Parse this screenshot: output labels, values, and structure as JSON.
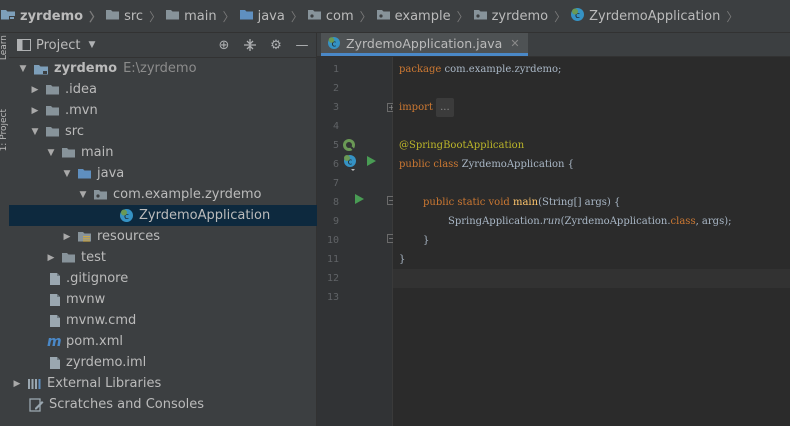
{
  "navbar": {
    "crumbs": [
      "zyrdemo",
      "src",
      "main",
      "java",
      "com",
      "example",
      "zyrdemo",
      "ZyrdemoApplication"
    ]
  },
  "strip": {
    "tab_top": "Learn",
    "tab_project": "1: Project"
  },
  "project_panel": {
    "title": "Project",
    "tree": [
      {
        "label": "zyrdemo",
        "hint": "E:\\zyrdemo"
      },
      {
        "label": ".idea"
      },
      {
        "label": ".mvn"
      },
      {
        "label": "src"
      },
      {
        "label": "main"
      },
      {
        "label": "java"
      },
      {
        "label": "com.example.zyrdemo"
      },
      {
        "label": "ZyrdemoApplication"
      },
      {
        "label": "resources"
      },
      {
        "label": "test"
      },
      {
        "label": ".gitignore"
      },
      {
        "label": "mvnw"
      },
      {
        "label": "mvnw.cmd"
      },
      {
        "label": "pom.xml"
      },
      {
        "label": "zyrdemo.iml"
      },
      {
        "label": "External Libraries"
      },
      {
        "label": "Scratches and Consoles"
      }
    ]
  },
  "editor": {
    "tab_label": "ZyrdemoApplication.java",
    "line_numbers": [
      "1",
      "2",
      "3",
      "4",
      "5",
      "6",
      "7",
      "8",
      "9",
      "10",
      "11",
      "12",
      "13"
    ],
    "code": {
      "l1_kw": "package",
      "l1_rest": " com.example.zyrdemo;",
      "l3_kw": "import",
      "l3_fold": "...",
      "l6_ann": "@SpringBootApplication",
      "l7_kw": "public class",
      "l7_rest": " ZyrdemoApplication {",
      "l9_kw": "public static void",
      "l9_fn": "main",
      "l9_rest": "(String[] args) {",
      "l10_pre": "SpringApplication.",
      "l10_call": "run",
      "l10_mid": "(ZyrdemoApplication.",
      "l10_kw": "class",
      "l10_post": ", args);",
      "l11": "}",
      "l12": "}"
    }
  },
  "colors": {
    "accent": "#4a88c7",
    "keyword": "#cc7832",
    "annotation": "#bbb529",
    "method": "#ffc66d",
    "folder": "#6e95b4",
    "run_green": "#499c54"
  }
}
